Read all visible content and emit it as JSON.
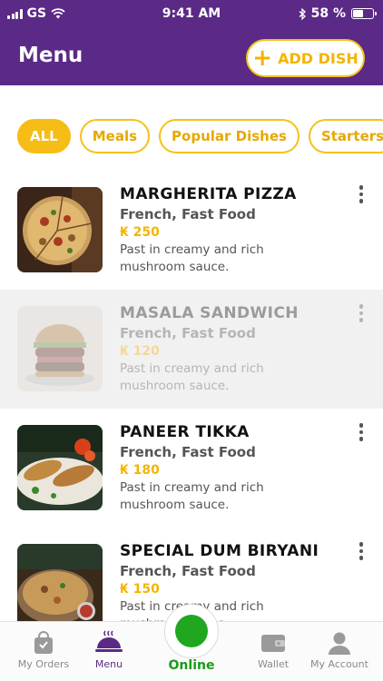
{
  "status_bar": {
    "carrier": "GS",
    "time": "9:41 AM",
    "battery": "58 %",
    "battery_level": 0.58
  },
  "header": {
    "title": "Menu",
    "add_button": "ADD DISH",
    "colors": {
      "bar": "#5b2a86",
      "accent": "#f4b400"
    }
  },
  "filters": [
    {
      "label": "ALL",
      "active": true
    },
    {
      "label": "Meals",
      "active": false
    },
    {
      "label": "Popular Dishes",
      "active": false
    },
    {
      "label": "Starters",
      "active": false
    },
    {
      "label": "",
      "active": false
    }
  ],
  "dishes": [
    {
      "name": "MARGHERITA PIZZA",
      "category": "French, Fast Food",
      "price": "₭ 250",
      "description": "Past in creamy and rich mushroom sauce.",
      "available": true,
      "image": "pizza-photo"
    },
    {
      "name": "MASALA SANDWICH",
      "category": "French, Fast Food",
      "price": "₭ 120",
      "description": "Past in creamy and rich mushroom sauce.",
      "available": false,
      "image": "burger-photo"
    },
    {
      "name": "PANEER TIKKA",
      "category": "French, Fast Food",
      "price": "₭ 180",
      "description": "Past in creamy and rich mushroom sauce.",
      "available": true,
      "image": "tikka-photo"
    },
    {
      "name": "SPECIAL DUM BIRYANI",
      "category": "French, Fast Food",
      "price": "₭ 150",
      "description": "Past in creamy and rich mushroom sauce.",
      "available": true,
      "image": "biryani-photo"
    }
  ],
  "tabbar": {
    "orders": "My Orders",
    "menu": "Menu",
    "online": "Online",
    "wallet": "Wallet",
    "account": "My Account"
  }
}
